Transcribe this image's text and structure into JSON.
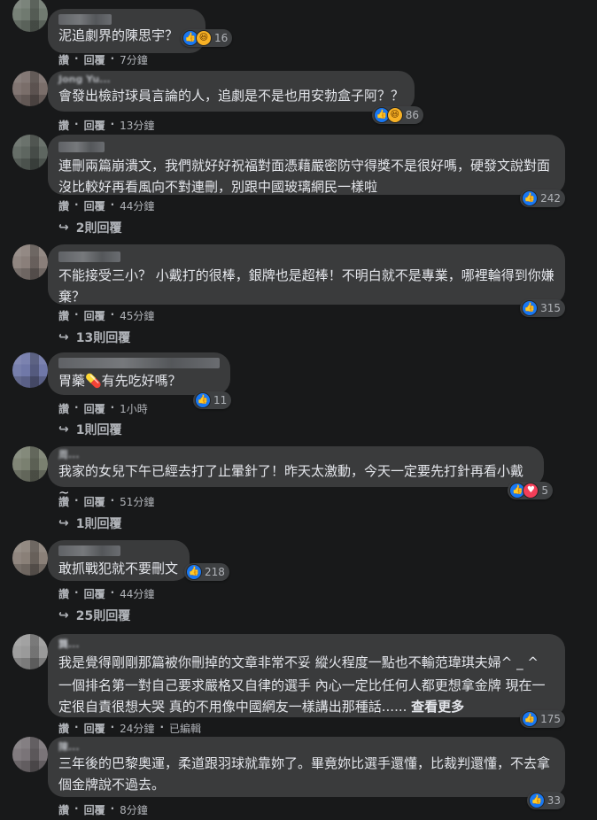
{
  "comments": [
    {
      "text": "泥追劇界的陳思宇？",
      "count": "16",
      "actions": {
        "like": "讚",
        "reply": "回覆",
        "time": "7分鐘"
      }
    },
    {
      "name": "Jong Yu...",
      "text": "會發出檢討球員言論的人，追劇是不是也用安勃盒子阿？？",
      "count": "86",
      "actions": {
        "like": "讚",
        "reply": "回覆",
        "time": "13分鐘"
      }
    },
    {
      "text": "連刪兩篇崩潰文，我們就好好祝福對面憑藉嚴密防守得獎不是很好嗎，硬發文說對面沒比較好再看風向不對連刪，別跟中國玻璃網民一樣啦",
      "count": "242",
      "actions": {
        "like": "讚",
        "reply": "回覆",
        "time": "44分鐘"
      },
      "replies": "2則回覆"
    },
    {
      "text": "不能接受三小？ 小戴打的很棒，銀牌也是超棒！不明白就不是專業，哪裡輪得到你嫌棄？",
      "count": "315",
      "actions": {
        "like": "讚",
        "reply": "回覆",
        "time": "45分鐘"
      },
      "replies": "13則回覆"
    },
    {
      "text": "胃藥💊有先吃好嗎？",
      "count": "11",
      "actions": {
        "like": "讚",
        "reply": "回覆",
        "time": "1小時"
      },
      "replies": "1則回覆"
    },
    {
      "name": "周...",
      "text": "我家的女兒下午已經去打了止暈針了！昨天太激動，今天一定要先打針再看小戴~",
      "count": "5",
      "actions": {
        "like": "讚",
        "reply": "回覆",
        "time": "51分鐘"
      },
      "replies": "1則回覆"
    },
    {
      "text": "敢抓戰犯就不要刪文",
      "count": "218",
      "actions": {
        "like": "讚",
        "reply": "回覆",
        "time": "44分鐘"
      },
      "replies": "25則回覆"
    },
    {
      "name": "龔...",
      "text": "我是覺得剛剛那篇被你刪掉的文章非常不妥 縱火程度一點也不輸范瑋琪夫婦^ _ ^",
      "text2": "一個排名第一對自己要求嚴格又自律的選手 內心一定比任何人都更想拿金牌 現在一定很自責很想大哭 真的不用像中國網友一樣講出那種話......",
      "more": "查看更多",
      "count": "175",
      "actions": {
        "like": "讚",
        "reply": "回覆",
        "time": "24分鐘",
        "edited": "已編輯"
      }
    },
    {
      "name": "陳...",
      "text": "三年後的巴黎奧運，柔道跟羽球就靠妳了。畢竟妳比選手還懂，比裁判還懂，不去拿個金牌說不過去。",
      "count": "33",
      "actions": {
        "like": "讚",
        "reply": "回覆",
        "time": "8分鐘"
      }
    }
  ],
  "icons": {
    "like": "like-icon",
    "haha": "haha-icon",
    "love": "love-icon",
    "reply_arrow": "reply-arrow-icon"
  },
  "colors": {
    "background": "#18191a",
    "bubble": "#3a3b3c",
    "text": "#e4e6eb",
    "secondary": "#b0b3b8",
    "like": "#1877f2",
    "haha": "#f7b125",
    "love": "#f33e58"
  }
}
